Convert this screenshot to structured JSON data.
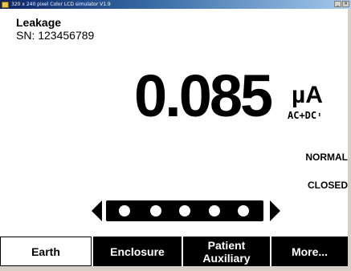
{
  "window": {
    "title": "320 x 240 pixel Color LCD simulator V1.9",
    "app_icon": "app-icon",
    "controls": [
      "minimize-icon",
      "close-icon"
    ],
    "minimize_glyph": "_",
    "close_glyph": "×",
    "accent_gradient": [
      "#0a246a",
      "#3a6ea5",
      "#a6caf0"
    ]
  },
  "header": {
    "measurement": "Leakage",
    "serial": "SN: 123456789"
  },
  "reading": {
    "value": "0.085",
    "unit": "µA",
    "coupling": "AC+DC",
    "coupling_icon": "up-down-arrows-icon",
    "coupling_glyph": "⬍"
  },
  "status": {
    "polarity": "NORMAL",
    "neutral": "CLOSED"
  },
  "selector": {
    "positions": 5,
    "left_icon": "left-arrow-icon",
    "right_icon": "right-arrow-icon"
  },
  "softkeys": [
    {
      "label": "Earth",
      "active": true
    },
    {
      "label": "Enclosure",
      "active": false
    },
    {
      "label": "Patient\nAuxiliary",
      "active": false
    },
    {
      "label": "More...",
      "active": false
    }
  ],
  "colors": {
    "background": "#ffffff",
    "foreground": "#000000",
    "softkey_active_bg": "#ffffff",
    "softkey_inactive_bg": "#000000"
  }
}
